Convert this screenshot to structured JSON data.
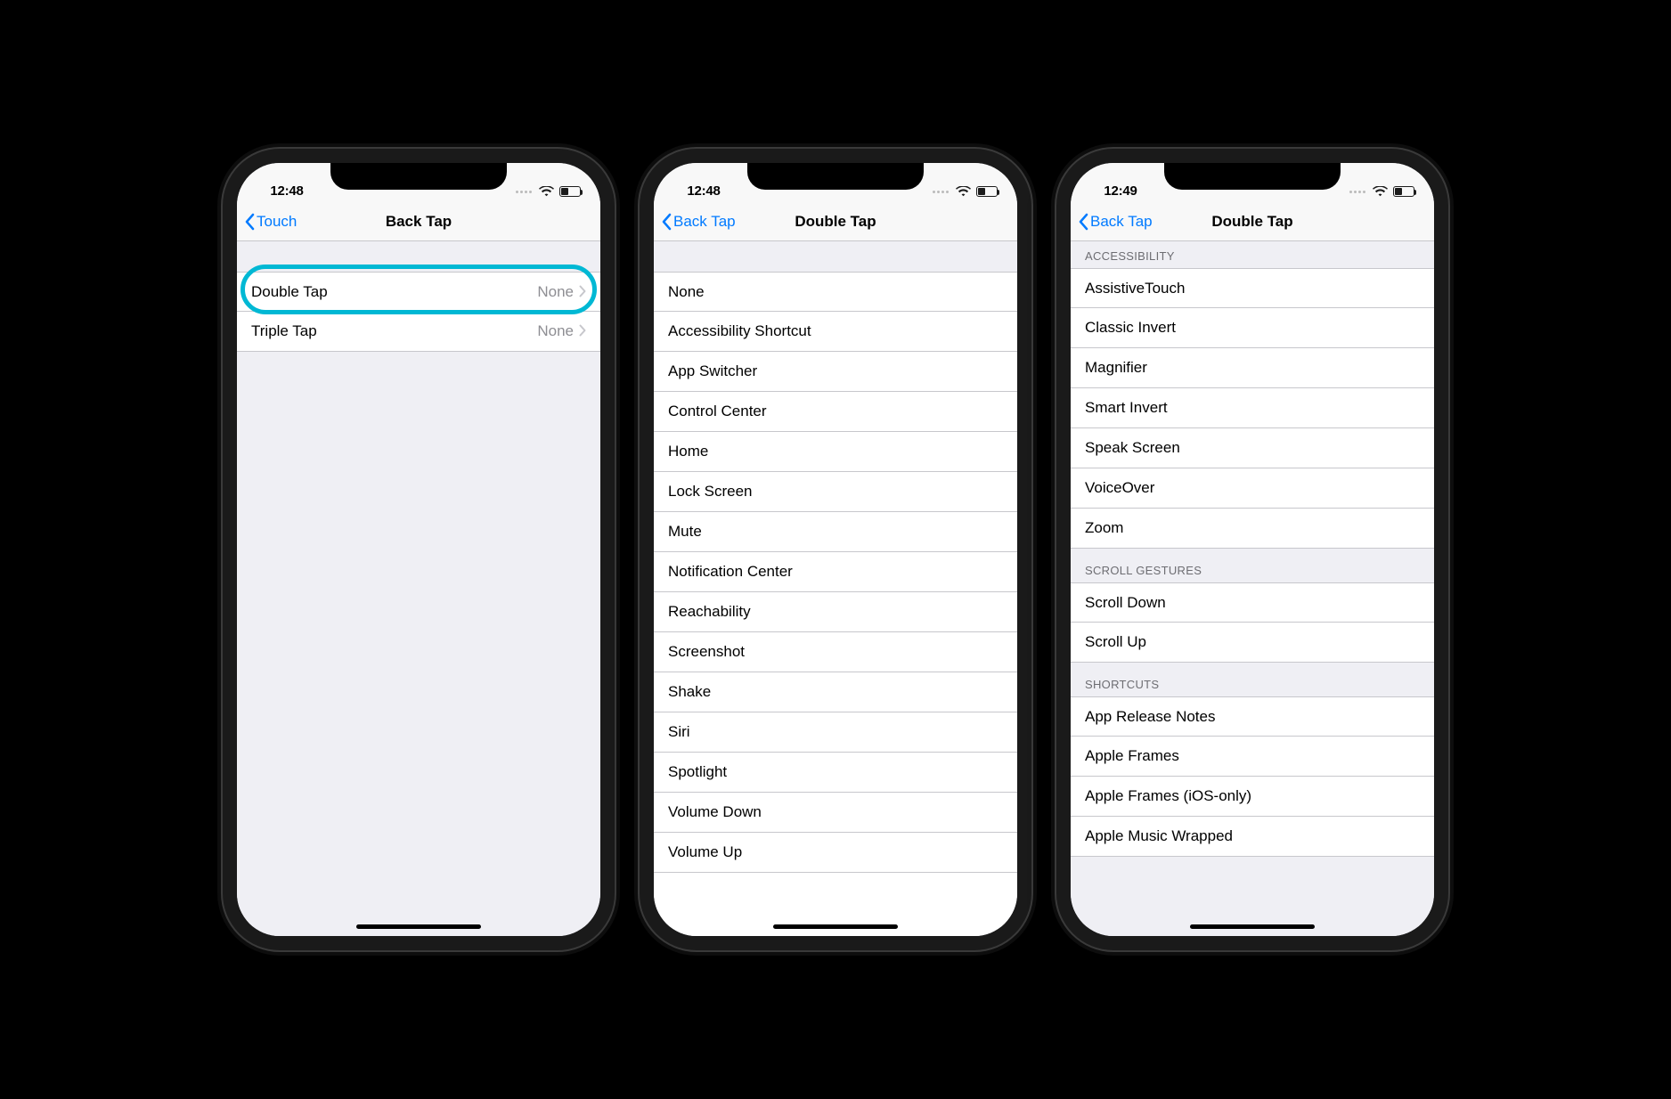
{
  "colors": {
    "ios_blue": "#007aff",
    "highlight": "#00b8d4"
  },
  "screen1": {
    "status_time": "12:48",
    "nav": {
      "back": "Touch",
      "title": "Back Tap"
    },
    "rows": [
      {
        "label": "Double Tap",
        "value": "None"
      },
      {
        "label": "Triple Tap",
        "value": "None"
      }
    ]
  },
  "screen2": {
    "status_time": "12:48",
    "nav": {
      "back": "Back Tap",
      "title": "Double Tap"
    },
    "options": [
      "None",
      "Accessibility Shortcut",
      "App Switcher",
      "Control Center",
      "Home",
      "Lock Screen",
      "Mute",
      "Notification Center",
      "Reachability",
      "Screenshot",
      "Shake",
      "Siri",
      "Spotlight",
      "Volume Down",
      "Volume Up"
    ]
  },
  "screen3": {
    "status_time": "12:49",
    "nav": {
      "back": "Back Tap",
      "title": "Double Tap"
    },
    "sections": [
      {
        "header": "ACCESSIBILITY",
        "items": [
          "AssistiveTouch",
          "Classic Invert",
          "Magnifier",
          "Smart Invert",
          "Speak Screen",
          "VoiceOver",
          "Zoom"
        ]
      },
      {
        "header": "SCROLL GESTURES",
        "items": [
          "Scroll Down",
          "Scroll Up"
        ]
      },
      {
        "header": "SHORTCUTS",
        "items": [
          "App Release Notes",
          "Apple Frames",
          "Apple Frames (iOS-only)",
          "Apple Music Wrapped"
        ]
      }
    ]
  }
}
